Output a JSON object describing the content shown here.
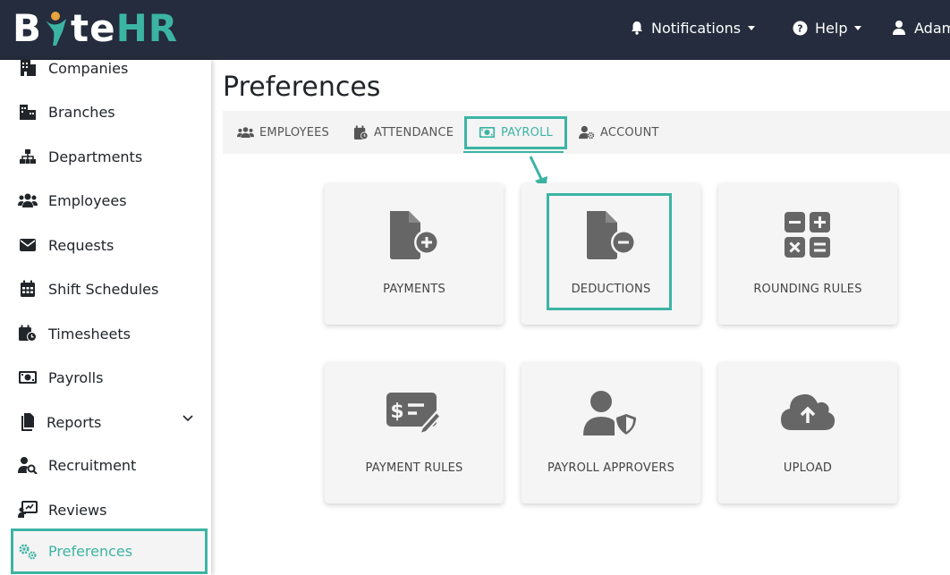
{
  "brand": {
    "logo_part1": "B",
    "logo_part2": "te",
    "logo_part3": "HR",
    "accent": "#3cb4a4",
    "navbar_bg": "#242c3d"
  },
  "navbar": {
    "notifications_label": "Notifications",
    "help_label": "Help",
    "user_label": "Adam"
  },
  "sidebar": {
    "items": [
      {
        "label": "Companies",
        "icon": "building-icon"
      },
      {
        "label": "Branches",
        "icon": "city-icon"
      },
      {
        "label": "Departments",
        "icon": "sitemap-icon"
      },
      {
        "label": "Employees",
        "icon": "users-icon"
      },
      {
        "label": "Requests",
        "icon": "envelope-icon"
      },
      {
        "label": "Shift Schedules",
        "icon": "calendar-icon"
      },
      {
        "label": "Timesheets",
        "icon": "calendar-clock-icon"
      },
      {
        "label": "Payrolls",
        "icon": "money-icon"
      },
      {
        "label": "Reports",
        "icon": "file-icon"
      },
      {
        "label": "Recruitment",
        "icon": "user-search-icon"
      },
      {
        "label": "Reviews",
        "icon": "presentation-icon"
      },
      {
        "label": "Preferences",
        "icon": "gears-icon",
        "active": true
      }
    ]
  },
  "main": {
    "title": "Preferences",
    "tabs": [
      {
        "label": "EMPLOYEES",
        "icon": "users-icon"
      },
      {
        "label": "ATTENDANCE",
        "icon": "calendar-check-icon"
      },
      {
        "label": "PAYROLL",
        "icon": "money-icon",
        "active": true
      },
      {
        "label": "ACCOUNT",
        "icon": "user-gear-icon"
      }
    ],
    "cards": [
      {
        "label": "PAYMENTS",
        "icon": "file-plus-icon"
      },
      {
        "label": "DEDUCTIONS",
        "icon": "file-minus-icon"
      },
      {
        "label": "ROUNDING RULES",
        "icon": "calculator-icon"
      },
      {
        "label": "PAYMENT RULES",
        "icon": "money-check-pen-icon"
      },
      {
        "label": "PAYROLL APPROVERS",
        "icon": "user-shield-icon"
      },
      {
        "label": "UPLOAD",
        "icon": "cloud-upload-icon"
      }
    ]
  }
}
